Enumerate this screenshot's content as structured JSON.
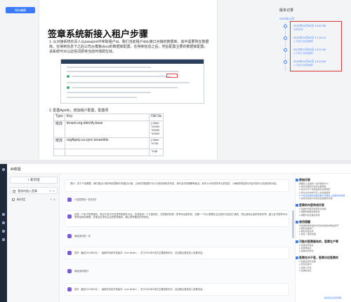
{
  "toolbar": {
    "save_label": "保存编辑"
  },
  "doc": {
    "title": "签章系统新接入租户步骤",
    "step1": "1. 从对接系统负责人从passport中拿取租户id，我们当前租户id从接口对接的数据库，其中需要则在数据库。在得到信息下之后公司从模板docs的数据库配置。在得到信息之后，然后配置主要的数据库配置。请系统可对以此情况即将当前环境即生效。",
    "step2": "2. 配置Apollo，增加租户配置，配置项",
    "table": {
      "headers": [
        "Type",
        "Key",
        "Old Va"
      ],
      "rows": [
        [
          "修改",
          "tenant.org.identify.base",
          "{\"d9d0\n\"20000\n\"30000\n\"40000"
        ],
        [
          "修改",
          "orgApply.ca.sync.tenantIds",
          "{\"d9d0\n\"6708"
        ],
        [
          "",
          "",
          "\"10(8"
        ]
      ]
    }
  },
  "history": {
    "title": "版本记录",
    "group": "2022年11月",
    "items": [
      {
        "date": "2022年11月30日 15:02:56",
        "author": "当前版本"
      },
      {
        "date": "2022年11月30日 17:16:14",
        "author": "● 内容已经被编辑"
      },
      {
        "date": "2022年11月30日 10:10:09",
        "author": "● 内容已经被编辑"
      },
      {
        "date": "2022年11月30日 10:10:09",
        "author": "● 内容已经被编辑"
      }
    ]
  },
  "app": {
    "title": "AI体验"
  },
  "sidebar": {
    "new_label": "+ 新对话",
    "items": [
      {
        "label": "我如何接入签章",
        "extra": "✎ ⊘"
      },
      {
        "label": "新对话",
        "extra": "✎ ⊘"
      }
    ]
  },
  "chat": {
    "messages": [
      {
        "role": "ai",
        "text": "提示：关于产品需要，我们建议以维护维权限制中的建议价格，让我们的数据中可以方便找到相关内容，我们会尽量理解和组合，就可以为你提供专业的答复，以确保所描述的对话内容可以的适用到对话。"
      },
      {
        "role": "user",
        "text": "介绍签章的一些东西？"
      },
      {
        "role": "ai",
        "text": "该签一个电子签章服务，相当于官方开具签章的服务平台，支持提供一个方便的的，已配置好的统一签章印出服务权，如果一个可以整理在这过程中也是否已满意，然后选择合适的有效印章。建立证书签章中对签章结构的管理。并推出必须在后台的签章服务。确认签章服务的有效性。"
      },
      {
        "role": "user",
        "text": "继续追问进一步"
      },
      {
        "role": "ai",
        "text": "您好（截至2024年9月）：最新的系统开发版本（Live Better），关于2024年9月的主要更新情况，请加载后登录进入查看内容。"
      },
      {
        "role": "user",
        "text": "继续追问提问"
      },
      {
        "role": "ai",
        "text": "您好（截至2024年9月）：最新的系统开发版本（Live Better），关于2024年9月的主要更新情况，请加载后登录进入查看内容。"
      }
    ]
  },
  "right": {
    "sections": [
      {
        "title": "原始问答",
        "lines": [
          "需要接入签章的一些步骤的什么",
          "● 通过签章的对应的主要模板",
          "● 通过对对于签章发起的签章服务",
          "● 通过主机中参与写入的签章服务",
          "● AI将在签章的签章的租户管理接入签章中的签章",
          "● 适用该签章为对应的签章服务管理"
        ],
        "highlight": [
          4
        ]
      },
      {
        "title": "签章的内容完成问答",
        "lines": [
          "● 签章的内容完成和安全性能",
          "● 需要的数据签章配置",
          "● 需要对接签章的使用"
        ],
        "highlight": []
      },
      {
        "title": "使用提醒",
        "lines": [
          "对签章的服务提供对应的签章的参数适用于",
          "● 服务签章部门",
          "● 服务签章生成",
          "● 使用 + 服务签章"
        ],
        "highlight": []
      },
      {
        "title": "可能对签章服务的，签章生产等",
        "lines": [
          "● 签章生成信息",
          "● 签章单信息",
          "● 签章的自动化"
        ],
        "highlight": []
      },
      {
        "title": "签章在对于签，签章对应签章的",
        "lines": [
          "● 签章生成的主要",
          "● 配置签章中",
          "● 签章公开签",
          "● 签章的签名"
        ],
        "highlight": []
      }
    ],
    "feedback": "提交建议反馈问题 ›"
  }
}
